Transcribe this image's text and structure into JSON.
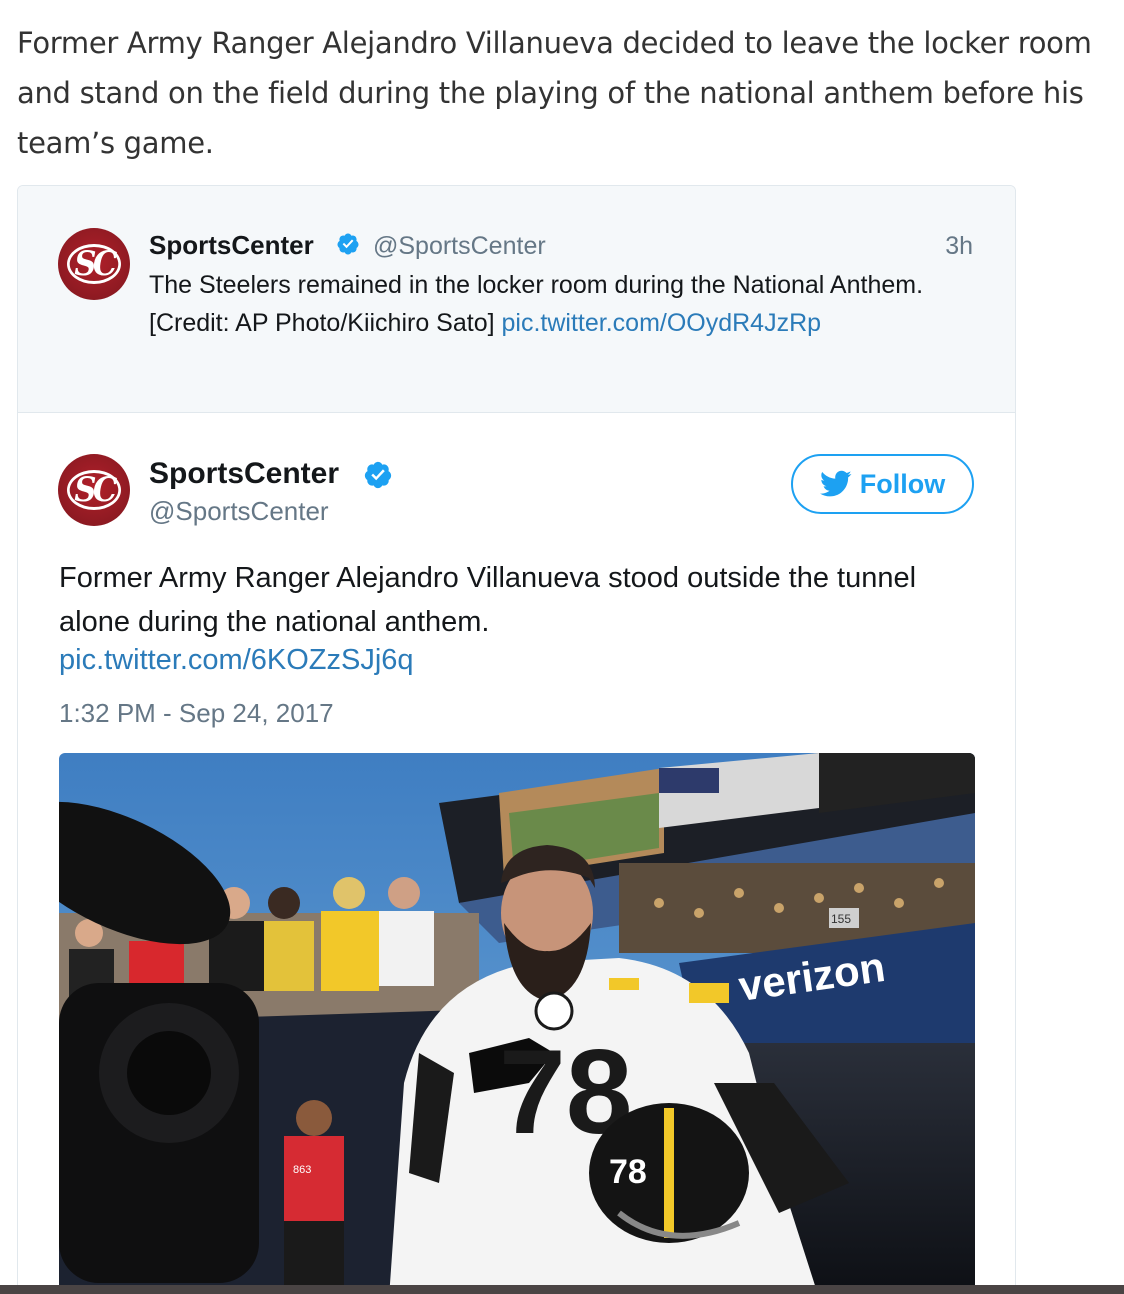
{
  "article": {
    "paragraph": "Former Army Ranger Alejandro Villanueva decided to leave the locker room and stand on the field during the playing of the national anthem before his team’s game."
  },
  "quoted_tweet": {
    "avatar_text": "SC",
    "name": "SportsCenter",
    "handle": "@SportsCenter",
    "time": "3h",
    "text_line1": "The Steelers remained in the locker room during the National Anthem.",
    "credit": "[Credit: AP Photo/Kiichiro Sato]",
    "link": "pic.twitter.com/OOydR4JzRp"
  },
  "tweet": {
    "avatar_text": "SC",
    "name": "SportsCenter",
    "handle": "@SportsCenter",
    "follow_label": "Follow",
    "text": "Former Army Ranger Alejandro Villanueva stood outside the tunnel alone during the national anthem.",
    "link": "pic.twitter.com/6KOZzSJj6q",
    "timestamp": "1:32 PM - Sep 24, 2017"
  },
  "photo": {
    "ad_text": "verizon",
    "section_number": "155",
    "jersey_number": "78",
    "helmet_number": "78",
    "badge_number": "863"
  },
  "colors": {
    "twitter_blue": "#1da1f2",
    "link_blue": "#2b7bb9",
    "sc_red": "#a01d26",
    "verified_blue": "#1da1f2",
    "muted_gray": "#657786"
  },
  "icons": [
    "verified-badge-icon",
    "twitter-bird-icon"
  ]
}
